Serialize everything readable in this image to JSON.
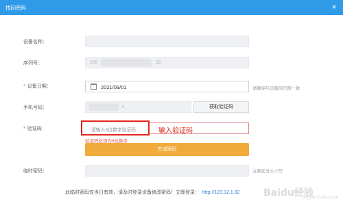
{
  "window": {
    "title": "找回密码",
    "close_glyph": "×"
  },
  "form": {
    "device_name": {
      "label": "设备名称：",
      "value": ""
    },
    "serial": {
      "label": "序列号：",
      "value_left": "210",
      "value_right": "32"
    },
    "device_date": {
      "label": "设备日期：",
      "value": "2021/09/01",
      "hint": "请确保与设备侧日期一致",
      "icon": "calendar-icon"
    },
    "phone": {
      "label": "手机号码：",
      "value": "3",
      "button": "获取验证码"
    },
    "verify_code": {
      "label": "验证码：",
      "placeholder": "请输入6位数字验证码",
      "annotation": "输入验证码",
      "error": "验证码必须为6位数字"
    },
    "generate_button": "生成密码",
    "temp_password": {
      "label": "临时密码：",
      "value": "",
      "hint": "注意区分大小写"
    },
    "required_mark": "*"
  },
  "footer": {
    "text": "此临时密码仅当日有效，请及时登录设备修改密码！立即登录：",
    "link": "http://123.12.1.82"
  },
  "watermark": {
    "brand": "Baidu经验",
    "sub": "jingyan.baidu.com"
  },
  "colors": {
    "titlebar": "#2f9ae8",
    "primary_button": "#f0ab3b",
    "error": "#e2261d",
    "link": "#2d7bd6"
  }
}
